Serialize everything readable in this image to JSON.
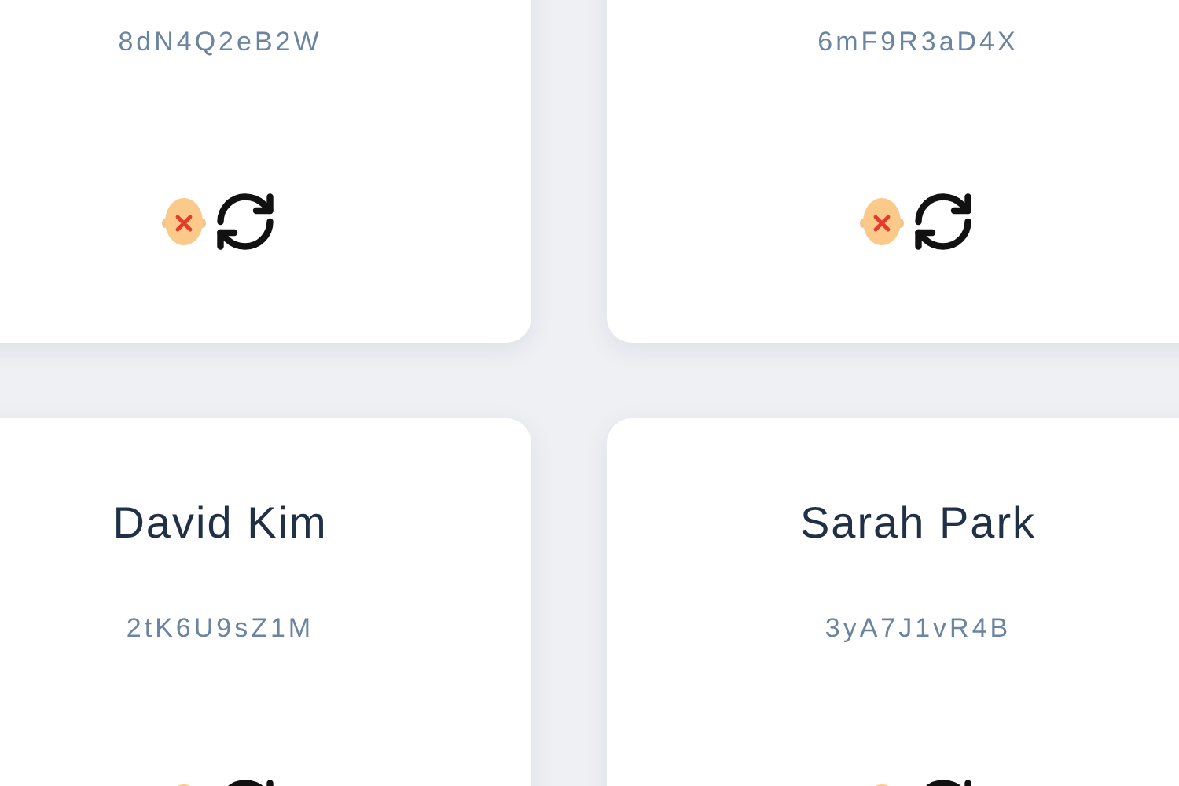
{
  "cards": [
    {
      "code": "8dN4Q2eB2W"
    },
    {
      "code": "6mF9R3aD4X"
    },
    {
      "name": "David Kim",
      "code": "2tK6U9sZ1M"
    },
    {
      "name": "Sarah Park",
      "code": "3yA7J1vR4B"
    }
  ]
}
